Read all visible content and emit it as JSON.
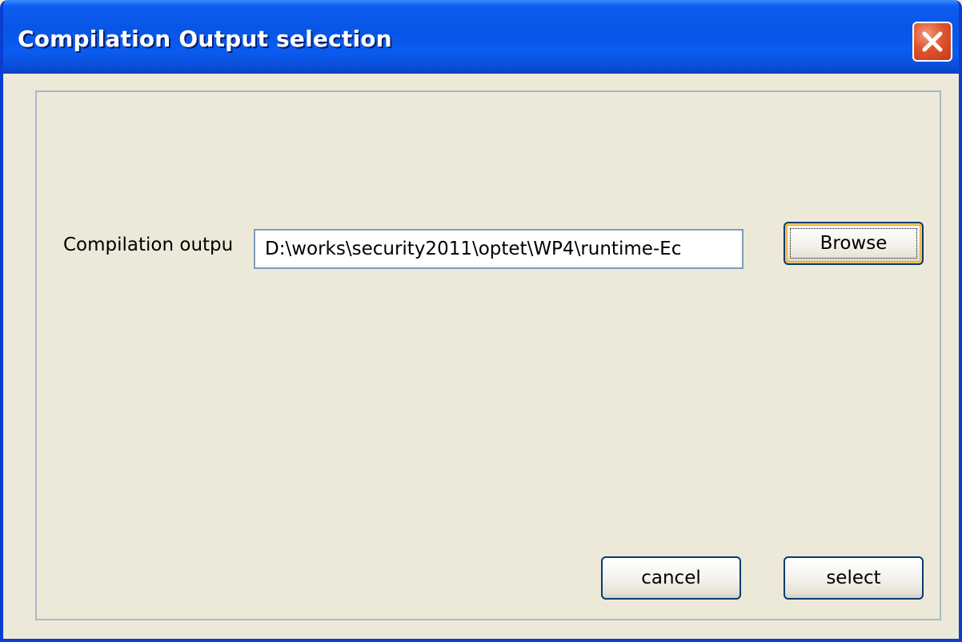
{
  "window": {
    "title": "Compilation Output selection"
  },
  "form": {
    "output_label": "Compilation outpu",
    "output_value": "D:\\works\\security2011\\optet\\WP4\\runtime-Ec"
  },
  "buttons": {
    "browse_label": "Browse",
    "cancel_label": "cancel",
    "select_label": "select"
  },
  "icons": {
    "close": "close-icon"
  },
  "colors": {
    "titlebar": "#0855E6",
    "window_background": "#ECE9D8",
    "close_button": "#E0552F",
    "focus_highlight": "#F9C65A"
  }
}
